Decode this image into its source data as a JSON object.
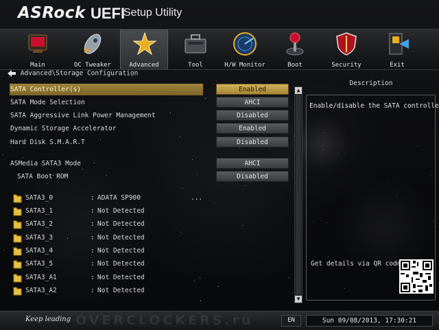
{
  "brand": {
    "logo": "ASRock",
    "uefi": "UEFI",
    "subtitle": "Setup Utility"
  },
  "menu": [
    {
      "label": "Main",
      "icon": "main-icon"
    },
    {
      "label": "OC Tweaker",
      "icon": "rocket-icon"
    },
    {
      "label": "Advanced",
      "icon": "star-icon",
      "active": true
    },
    {
      "label": "Tool",
      "icon": "toolbox-icon"
    },
    {
      "label": "H/W Monitor",
      "icon": "radar-icon"
    },
    {
      "label": "Boot",
      "icon": "joystick-icon"
    },
    {
      "label": "Security",
      "icon": "shield-icon"
    },
    {
      "label": "Exit",
      "icon": "exit-door-icon"
    }
  ],
  "breadcrumb": "Advanced\\Storage Configuration",
  "settings": [
    {
      "label": "SATA Controller(s)",
      "value": "Enabled"
    },
    {
      "label": "SATA Mode Selection",
      "value": "AHCI"
    },
    {
      "label": "SATA Aggressive Link Power Management",
      "value": "Disabled"
    },
    {
      "label": "Dynamic Storage Accelerator",
      "value": "Enabled"
    },
    {
      "label": "Hard Disk S.M.A.R.T",
      "value": "Disabled"
    },
    {
      "label": "ASMedia SATA3 Mode",
      "value": "AHCI"
    },
    {
      "label": "SATA Boot ROM",
      "value": "Disabled"
    }
  ],
  "drives": [
    {
      "port": "SATA3_0",
      "device": "ADATA SP900",
      "more": "..."
    },
    {
      "port": "SATA3_1",
      "device": "Not Detected"
    },
    {
      "port": "SATA3_2",
      "device": "Not Detected"
    },
    {
      "port": "SATA3_3",
      "device": "Not Detected"
    },
    {
      "port": "SATA3_4",
      "device": "Not Detected"
    },
    {
      "port": "SATA3_5",
      "device": "Not Detected"
    },
    {
      "port": "SATA3_A1",
      "device": "Not Detected"
    },
    {
      "port": "SATA3_A2",
      "device": "Not Detected"
    }
  ],
  "description": {
    "title": "Description",
    "text": "Enable/disable the SATA controllers.",
    "qr_label": "Get details via QR code"
  },
  "footer": {
    "slogan": "Keep leading",
    "watermark": "OVERCLOCKERS.ru",
    "language": "EN",
    "datetime": "Sun 09/08/2013, 17:30:21"
  },
  "colors": {
    "selected_gold": "#a0843c",
    "accent_red": "#c8102e"
  }
}
